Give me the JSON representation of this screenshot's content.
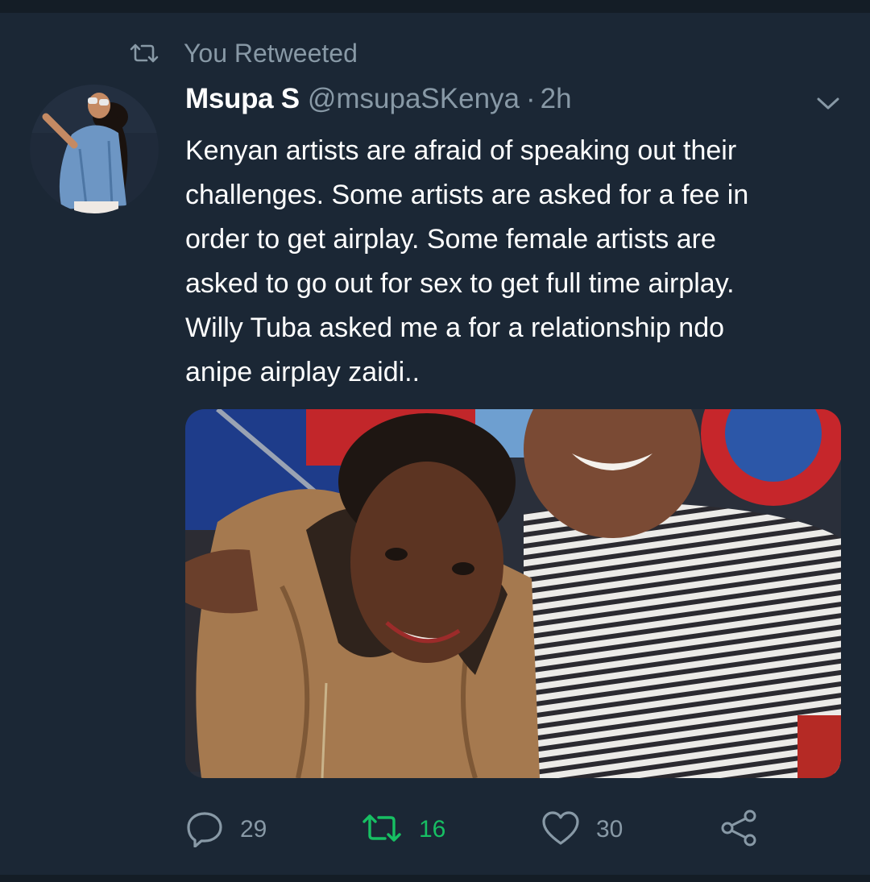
{
  "retweet_context": {
    "icon": "retweet-icon",
    "label": "You Retweeted"
  },
  "tweet": {
    "display_name": "Msupa S",
    "handle": "@msupaSKenya",
    "separator": "·",
    "time": "2h",
    "text_lines": [
      "Kenyan artists are afraid of speaking out their",
      "challenges. Some artists are asked for a fee in",
      "order to get airplay. Some female artists are",
      "asked to go out for sex to get full time airplay.",
      "Willy Tuba asked me a for a relationship ndo",
      "anipe airplay zaidi.."
    ],
    "media": {
      "type": "photo"
    }
  },
  "actions": {
    "reply": {
      "icon": "reply-icon",
      "count": "29"
    },
    "retweet": {
      "icon": "retweet-icon",
      "count": "16",
      "active": true
    },
    "like": {
      "icon": "heart-icon",
      "count": "30"
    },
    "share": {
      "icon": "share-icon"
    }
  },
  "colors": {
    "background": "#1b2735",
    "secondary_text": "#8899a6",
    "retweet_active": "#17bf63",
    "text": "#ffffff"
  }
}
